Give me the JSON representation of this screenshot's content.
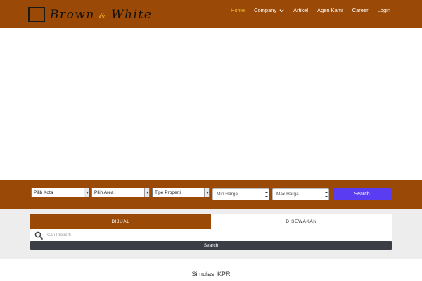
{
  "header": {
    "logo": {
      "word1": "Brown",
      "amp": "&",
      "word2": "White"
    },
    "nav": [
      {
        "label": "Home",
        "active": true
      },
      {
        "label": "Company",
        "has_dropdown": true
      },
      {
        "label": "Artikel"
      },
      {
        "label": "Agen Kami"
      },
      {
        "label": "Career"
      },
      {
        "label": "Login"
      }
    ]
  },
  "filters": {
    "kota": "Pilih Kota",
    "area": "Pilih Area",
    "tipe": "Tipe Properti",
    "min_harga_placeholder": "Min Harga",
    "max_harga_placeholder": "Max Harga",
    "search_label": "Search"
  },
  "tabs": [
    {
      "label": "DIJUAL",
      "active": true
    },
    {
      "label": "DISEWAKAN",
      "active": false
    }
  ],
  "search": {
    "placeholder": "Cari Properti",
    "button_label": "Search"
  },
  "simulasi": {
    "title": "Simulasi KPR"
  },
  "colors": {
    "brand_brown": "#9a4a06",
    "accent_yellow": "#f2c230",
    "search_purple": "#5a3cf2",
    "dark_button": "#3b3e45"
  }
}
